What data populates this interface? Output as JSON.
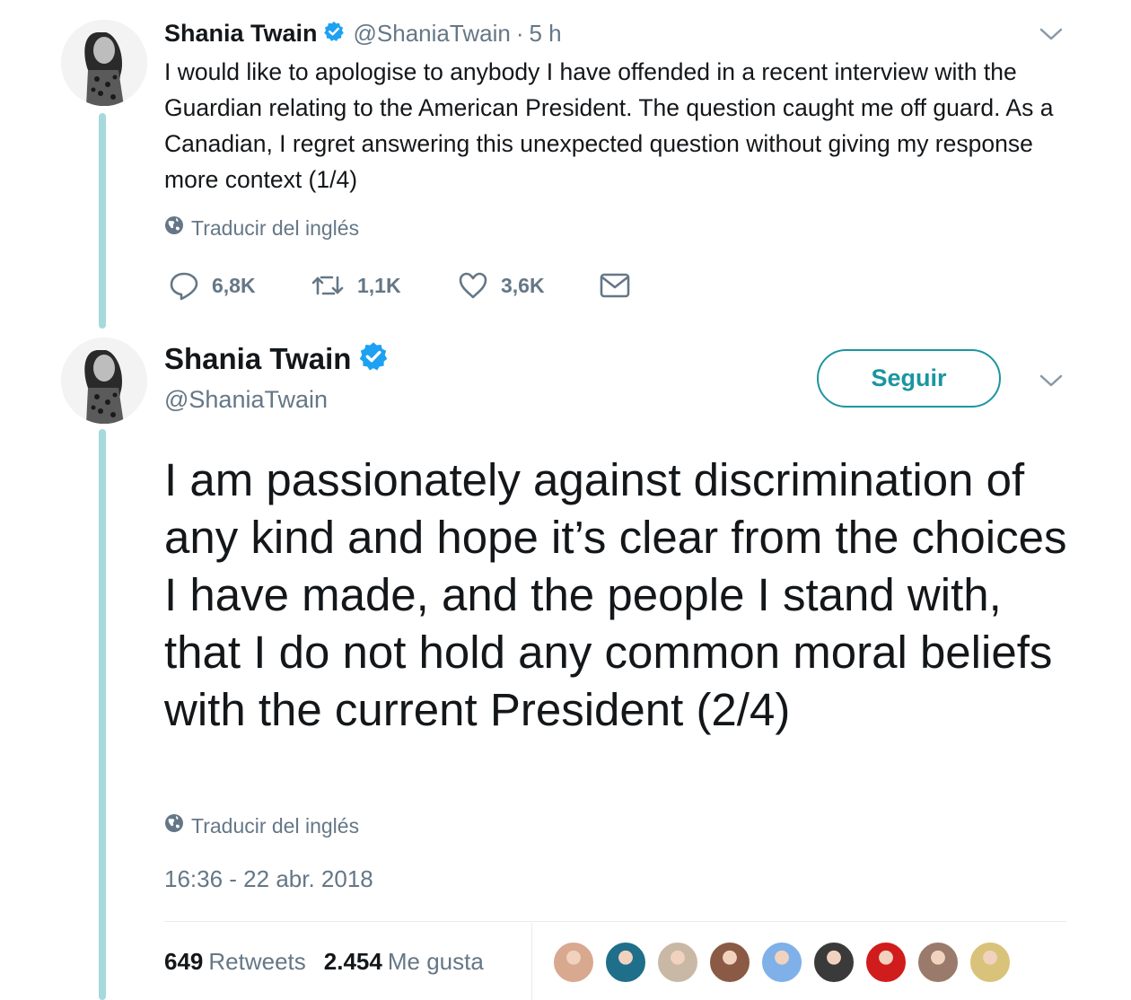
{
  "tweet1": {
    "name": "Shania Twain",
    "handle": "@ShaniaTwain",
    "separator": "·",
    "time": "5 h",
    "text": "I would like to apologise to anybody I have offended in a recent interview with the Guardian relating to the American President.  The question caught me off guard. As a Canadian, I regret answering this unexpected question without giving my response more context (1/4)",
    "translate": "Traducir del inglés",
    "actions": {
      "replies": "6,8K",
      "retweets": "1,1K",
      "likes": "3,6K"
    }
  },
  "tweet2": {
    "name": "Shania Twain",
    "handle": "@ShaniaTwain",
    "follow_label": "Seguir",
    "text": "I am passionately against discrimination of any kind and hope it’s clear from the choices I have made, and the people I stand with, that I do not hold any common moral beliefs with the current President (2/4)",
    "translate": "Traducir del inglés",
    "timestamp": "16:36 - 22 abr. 2018",
    "stats": {
      "retweets_count": "649",
      "retweets_label": "Retweets",
      "likes_count": "2.454",
      "likes_label": "Me gusta"
    },
    "likers": [
      "#d8a98f",
      "#1f6f8b",
      "#c9b8a6",
      "#8a5a44",
      "#7fb0e8",
      "#3a3a3a",
      "#d01c1c",
      "#9a7a6a",
      "#d9c27a"
    ]
  },
  "colors": {
    "accent": "#1b95a0",
    "verified": "#1da1f2",
    "thread_line": "#a6d9dc",
    "muted": "#657786"
  },
  "icons": [
    "verified-badge-icon",
    "chevron-down-icon",
    "globe-icon",
    "reply-icon",
    "retweet-icon",
    "like-icon",
    "direct-message-icon"
  ]
}
